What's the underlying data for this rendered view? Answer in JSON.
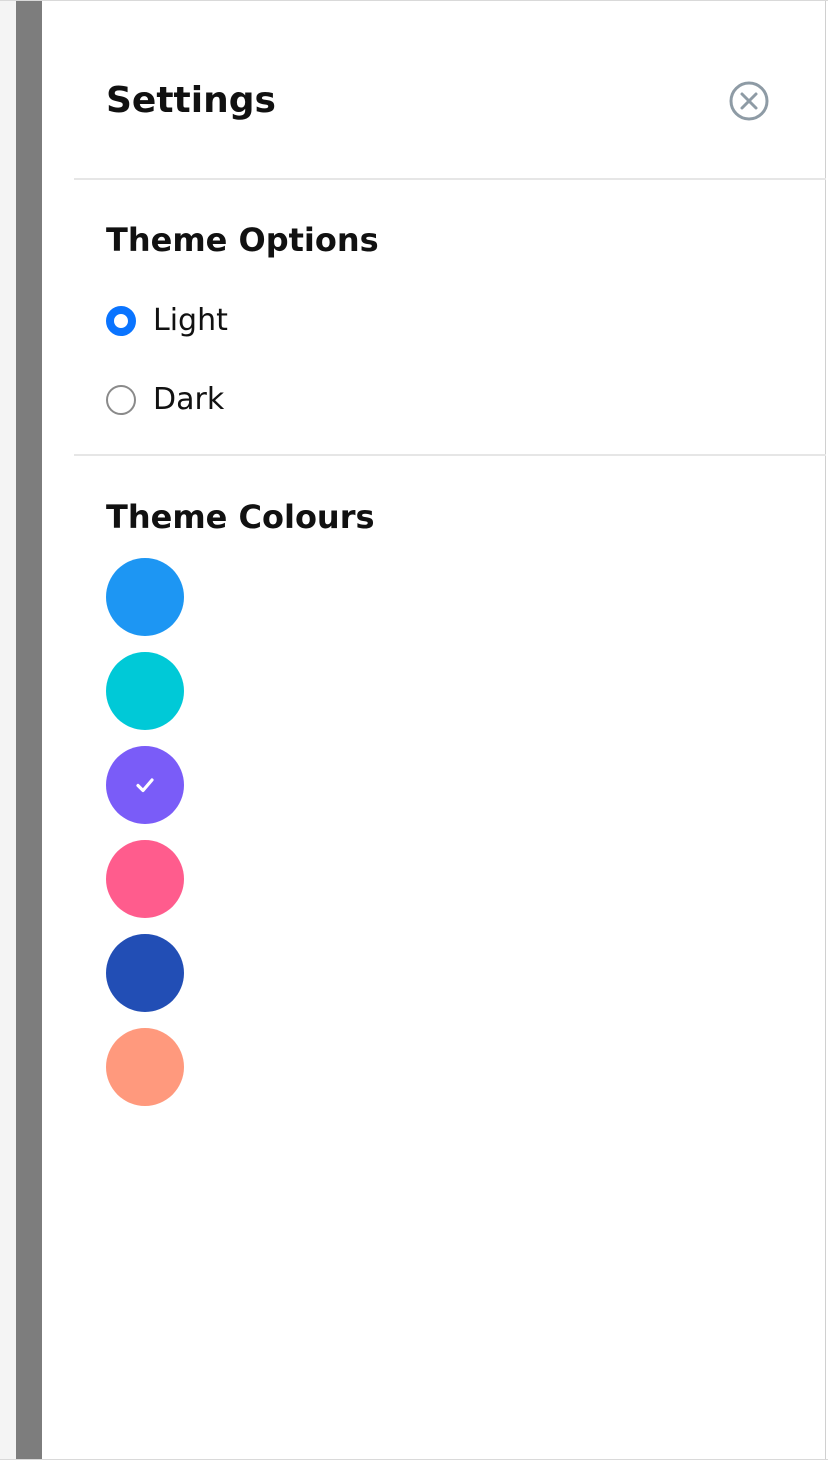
{
  "panel": {
    "title": "Settings",
    "close_icon": "close-circle-icon"
  },
  "theme_options": {
    "title": "Theme Options",
    "selected": "Light",
    "options": [
      {
        "label": "Light",
        "checked": true
      },
      {
        "label": "Dark",
        "checked": false
      }
    ],
    "accent_color": "#0a74ff"
  },
  "theme_colours": {
    "title": "Theme Colours",
    "selected_index": 2,
    "check_icon": "checkmark-icon",
    "swatches": [
      {
        "color": "#1d96f3",
        "selected": false
      },
      {
        "color": "#00c9d7",
        "selected": false
      },
      {
        "color": "#7a5cf8",
        "selected": true
      },
      {
        "color": "#ff5c8d",
        "selected": false
      },
      {
        "color": "#224eb5",
        "selected": false
      },
      {
        "color": "#ff997d",
        "selected": false
      }
    ]
  }
}
